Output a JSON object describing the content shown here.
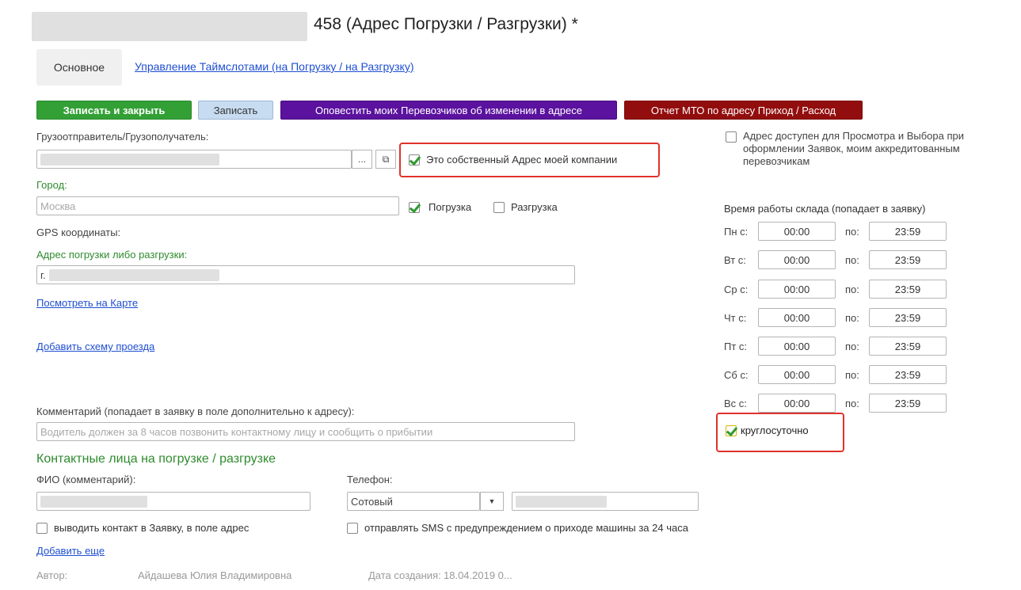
{
  "header": {
    "title": "458 (Адрес Погрузки / Разгрузки) *"
  },
  "tabs": [
    {
      "label": "Основное"
    },
    {
      "label": "Управление Таймслотами (на Погрузку / на Разгрузку)"
    }
  ],
  "toolbar": {
    "save_close": "Записать и закрыть",
    "save": "Записать",
    "notify": "Оповестить моих Перевозчиков об изменении в адресе",
    "report": "Отчет МТО по адресу Приход / Расход"
  },
  "form": {
    "shipper_label": "Грузоотправитель/Грузополучатель:",
    "select_btn": "...",
    "open_btn": "⧉",
    "own_address_label": "Это собственный Адрес моей компании",
    "city_label": "Город:",
    "city_placeholder": "Москва",
    "loading_label": "Погрузка",
    "unloading_label": "Разгрузка",
    "gps_label": "GPS координаты:",
    "address_label": "Адрес погрузки либо разгрузки:",
    "address_value": "г.",
    "map_link": "Посмотреть на Карте",
    "scheme_link": "Добавить схему проезда",
    "comment_label": "Комментарий (попадает в заявку в поле дополнительно к адресу):",
    "comment_placeholder": "Водитель должен за 8 часов позвонить контактному лицу и сообщить о прибытии"
  },
  "availability": {
    "label": "Адрес доступен для Просмотра и Выбора при оформлении Заявок, моим аккредитованным перевозчикам"
  },
  "schedule": {
    "title": "Время работы склада (попадает в заявку)",
    "to_label": "по:",
    "days": [
      {
        "label": "Пн с:",
        "from": "00:00",
        "to": "23:59"
      },
      {
        "label": "Вт с:",
        "from": "00:00",
        "to": "23:59"
      },
      {
        "label": "Ср с:",
        "from": "00:00",
        "to": "23:59"
      },
      {
        "label": "Чт с:",
        "from": "00:00",
        "to": "23:59"
      },
      {
        "label": "Пт с:",
        "from": "00:00",
        "to": "23:59"
      },
      {
        "label": "Сб с:",
        "from": "00:00",
        "to": "23:59"
      },
      {
        "label": "Вс с:",
        "from": "00:00",
        "to": "23:59"
      }
    ],
    "round_clock_label": "круглосуточно"
  },
  "contacts": {
    "title": "Контактные лица на погрузке / разгрузке",
    "fio_label": "ФИО (комментарий):",
    "phone_label": "Телефон:",
    "phone_type": "Сотовый",
    "show_in_order_label": "выводить контакт в Заявку, в поле адрес",
    "sms_label": "отправлять SMS с предупреждением о приходе машины за 24 часа",
    "add_more": "Добавить еще"
  },
  "footer": {
    "author_label": "Автор:",
    "author": "Айдашева Юлия Владимировна",
    "created_label": "Дата создания:",
    "created": "18.04.2019 0..."
  },
  "colors": {
    "primary_green": "#33a036",
    "link_blue": "#1f4fd1",
    "purple": "#5b129e",
    "dark_red": "#920e0e",
    "highlight_red": "#e0322c"
  }
}
